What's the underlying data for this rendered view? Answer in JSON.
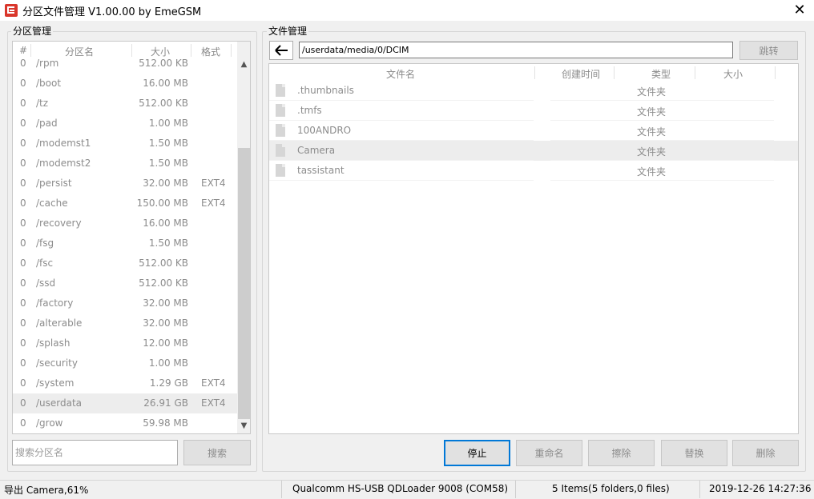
{
  "window": {
    "title": "分区文件管理 V1.00.00 by EmeGSM",
    "close_label": "✕"
  },
  "partition_panel": {
    "legend": "分区管理",
    "columns": [
      "#",
      "分区名",
      "大小",
      "格式"
    ],
    "rows": [
      {
        "num": "0",
        "name": "/rpm",
        "size": "512.00 KB",
        "format": ""
      },
      {
        "num": "0",
        "name": "/boot",
        "size": "16.00 MB",
        "format": ""
      },
      {
        "num": "0",
        "name": "/tz",
        "size": "512.00 KB",
        "format": ""
      },
      {
        "num": "0",
        "name": "/pad",
        "size": "1.00 MB",
        "format": ""
      },
      {
        "num": "0",
        "name": "/modemst1",
        "size": "1.50 MB",
        "format": ""
      },
      {
        "num": "0",
        "name": "/modemst2",
        "size": "1.50 MB",
        "format": ""
      },
      {
        "num": "0",
        "name": "/persist",
        "size": "32.00 MB",
        "format": "EXT4"
      },
      {
        "num": "0",
        "name": "/cache",
        "size": "150.00 MB",
        "format": "EXT4"
      },
      {
        "num": "0",
        "name": "/recovery",
        "size": "16.00 MB",
        "format": ""
      },
      {
        "num": "0",
        "name": "/fsg",
        "size": "1.50 MB",
        "format": ""
      },
      {
        "num": "0",
        "name": "/fsc",
        "size": "512.00 KB",
        "format": ""
      },
      {
        "num": "0",
        "name": "/ssd",
        "size": "512.00 KB",
        "format": ""
      },
      {
        "num": "0",
        "name": "/factory",
        "size": "32.00 MB",
        "format": ""
      },
      {
        "num": "0",
        "name": "/alterable",
        "size": "32.00 MB",
        "format": ""
      },
      {
        "num": "0",
        "name": "/splash",
        "size": "12.00 MB",
        "format": ""
      },
      {
        "num": "0",
        "name": "/security",
        "size": "1.00 MB",
        "format": ""
      },
      {
        "num": "0",
        "name": "/system",
        "size": "1.29 GB",
        "format": "EXT4"
      },
      {
        "num": "0",
        "name": "/userdata",
        "size": "26.91 GB",
        "format": "EXT4",
        "selected": true
      },
      {
        "num": "0",
        "name": "/grow",
        "size": "59.98 MB",
        "format": ""
      }
    ],
    "search_placeholder": "搜索分区名",
    "search_button": "搜索"
  },
  "file_panel": {
    "legend": "文件管理",
    "path": "/userdata/media/0/DCIM",
    "jump_button": "跳转",
    "columns": [
      "文件名",
      "创建时间",
      "类型",
      "大小"
    ],
    "rows": [
      {
        "name": ".thumbnails",
        "created": "",
        "type": "文件夹",
        "size": ""
      },
      {
        "name": ".tmfs",
        "created": "",
        "type": "文件夹",
        "size": ""
      },
      {
        "name": "100ANDRO",
        "created": "",
        "type": "文件夹",
        "size": ""
      },
      {
        "name": "Camera",
        "created": "",
        "type": "文件夹",
        "size": "",
        "selected": true
      },
      {
        "name": "tassistant",
        "created": "",
        "type": "文件夹",
        "size": ""
      }
    ],
    "buttons": {
      "stop": "停止",
      "rename": "重命名",
      "erase": "擦除",
      "replace": "替换",
      "delete": "删除"
    }
  },
  "status": {
    "export": "导出 Camera,61%",
    "export_progress_percent": 61,
    "device": "Qualcomm HS-USB QDLoader 9008 (COM58)",
    "items": "5 Items(5 folders,0 files)",
    "datetime": "2019-12-26 14:27:36"
  },
  "colors": {
    "accent": "#0078d7",
    "logo": "#d9362b",
    "selected_row": "#ededed"
  }
}
